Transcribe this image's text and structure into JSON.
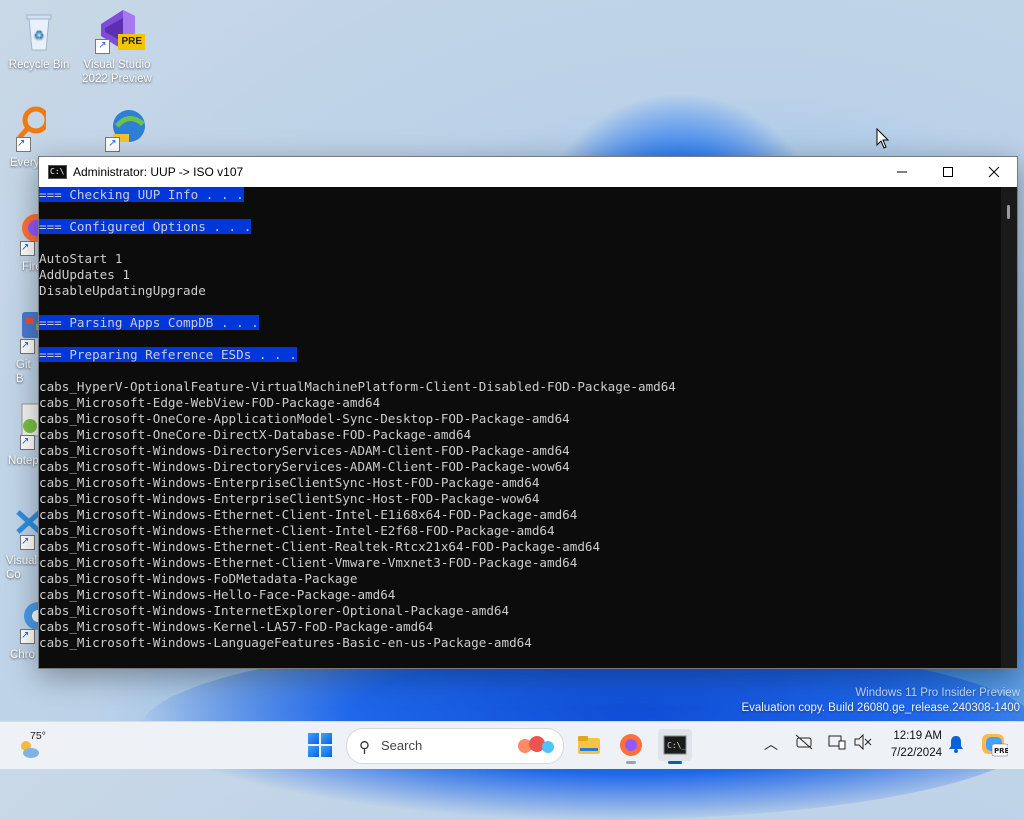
{
  "desktop": {
    "icons": [
      {
        "label": "Recycle Bin"
      },
      {
        "label": "Visual Studio 2022 Preview",
        "badge": "PRE"
      },
      {
        "label": "Every"
      },
      {
        "label": ""
      },
      {
        "label": "Fire"
      },
      {
        "label": "Git B"
      },
      {
        "label": "Notep"
      },
      {
        "label": "Visual Co"
      },
      {
        "label": "Chro"
      }
    ]
  },
  "window": {
    "title": "Administrator:  UUP -> ISO v107",
    "lines": [
      {
        "text": "=== Checking UUP Info . . .",
        "highlight": true
      },
      {
        "text": "",
        "highlight": false
      },
      {
        "text": "=== Configured Options . . .",
        "highlight": true
      },
      {
        "text": "",
        "highlight": false
      },
      {
        "text": "AutoStart 1",
        "highlight": false
      },
      {
        "text": "AddUpdates 1",
        "highlight": false
      },
      {
        "text": "DisableUpdatingUpgrade",
        "highlight": false
      },
      {
        "text": "",
        "highlight": false
      },
      {
        "text": "=== Parsing Apps CompDB . . .",
        "highlight": true
      },
      {
        "text": "",
        "highlight": false
      },
      {
        "text": "=== Preparing Reference ESDs . . .",
        "highlight": true
      },
      {
        "text": "",
        "highlight": false
      },
      {
        "text": "cabs_HyperV-OptionalFeature-VirtualMachinePlatform-Client-Disabled-FOD-Package-amd64",
        "highlight": false
      },
      {
        "text": "cabs_Microsoft-Edge-WebView-FOD-Package-amd64",
        "highlight": false
      },
      {
        "text": "cabs_Microsoft-OneCore-ApplicationModel-Sync-Desktop-FOD-Package-amd64",
        "highlight": false
      },
      {
        "text": "cabs_Microsoft-OneCore-DirectX-Database-FOD-Package-amd64",
        "highlight": false
      },
      {
        "text": "cabs_Microsoft-Windows-DirectoryServices-ADAM-Client-FOD-Package-amd64",
        "highlight": false
      },
      {
        "text": "cabs_Microsoft-Windows-DirectoryServices-ADAM-Client-FOD-Package-wow64",
        "highlight": false
      },
      {
        "text": "cabs_Microsoft-Windows-EnterpriseClientSync-Host-FOD-Package-amd64",
        "highlight": false
      },
      {
        "text": "cabs_Microsoft-Windows-EnterpriseClientSync-Host-FOD-Package-wow64",
        "highlight": false
      },
      {
        "text": "cabs_Microsoft-Windows-Ethernet-Client-Intel-E1i68x64-FOD-Package-amd64",
        "highlight": false
      },
      {
        "text": "cabs_Microsoft-Windows-Ethernet-Client-Intel-E2f68-FOD-Package-amd64",
        "highlight": false
      },
      {
        "text": "cabs_Microsoft-Windows-Ethernet-Client-Realtek-Rtcx21x64-FOD-Package-amd64",
        "highlight": false
      },
      {
        "text": "cabs_Microsoft-Windows-Ethernet-Client-Vmware-Vmxnet3-FOD-Package-amd64",
        "highlight": false
      },
      {
        "text": "cabs_Microsoft-Windows-FoDMetadata-Package",
        "highlight": false
      },
      {
        "text": "cabs_Microsoft-Windows-Hello-Face-Package-amd64",
        "highlight": false
      },
      {
        "text": "cabs_Microsoft-Windows-InternetExplorer-Optional-Package-amd64",
        "highlight": false
      },
      {
        "text": "cabs_Microsoft-Windows-Kernel-LA57-FoD-Package-amd64",
        "highlight": false
      },
      {
        "text": "cabs_Microsoft-Windows-LanguageFeatures-Basic-en-us-Package-amd64",
        "highlight": false
      }
    ]
  },
  "watermark": {
    "line1": "Windows 11 Pro Insider Preview",
    "line2": "Evaluation copy. Build 26080.ge_release.240308-1400"
  },
  "taskbar": {
    "weather_temp": "75°",
    "search_label": "Search",
    "time": "12:19 AM",
    "date": "7/22/2024",
    "apps": [
      "file-explorer",
      "firefox",
      "terminal"
    ]
  },
  "colors": {
    "console_bg": "#0c0c0c",
    "console_text": "#cccccc",
    "selection": "#0037da",
    "accent": "#005fb8"
  }
}
